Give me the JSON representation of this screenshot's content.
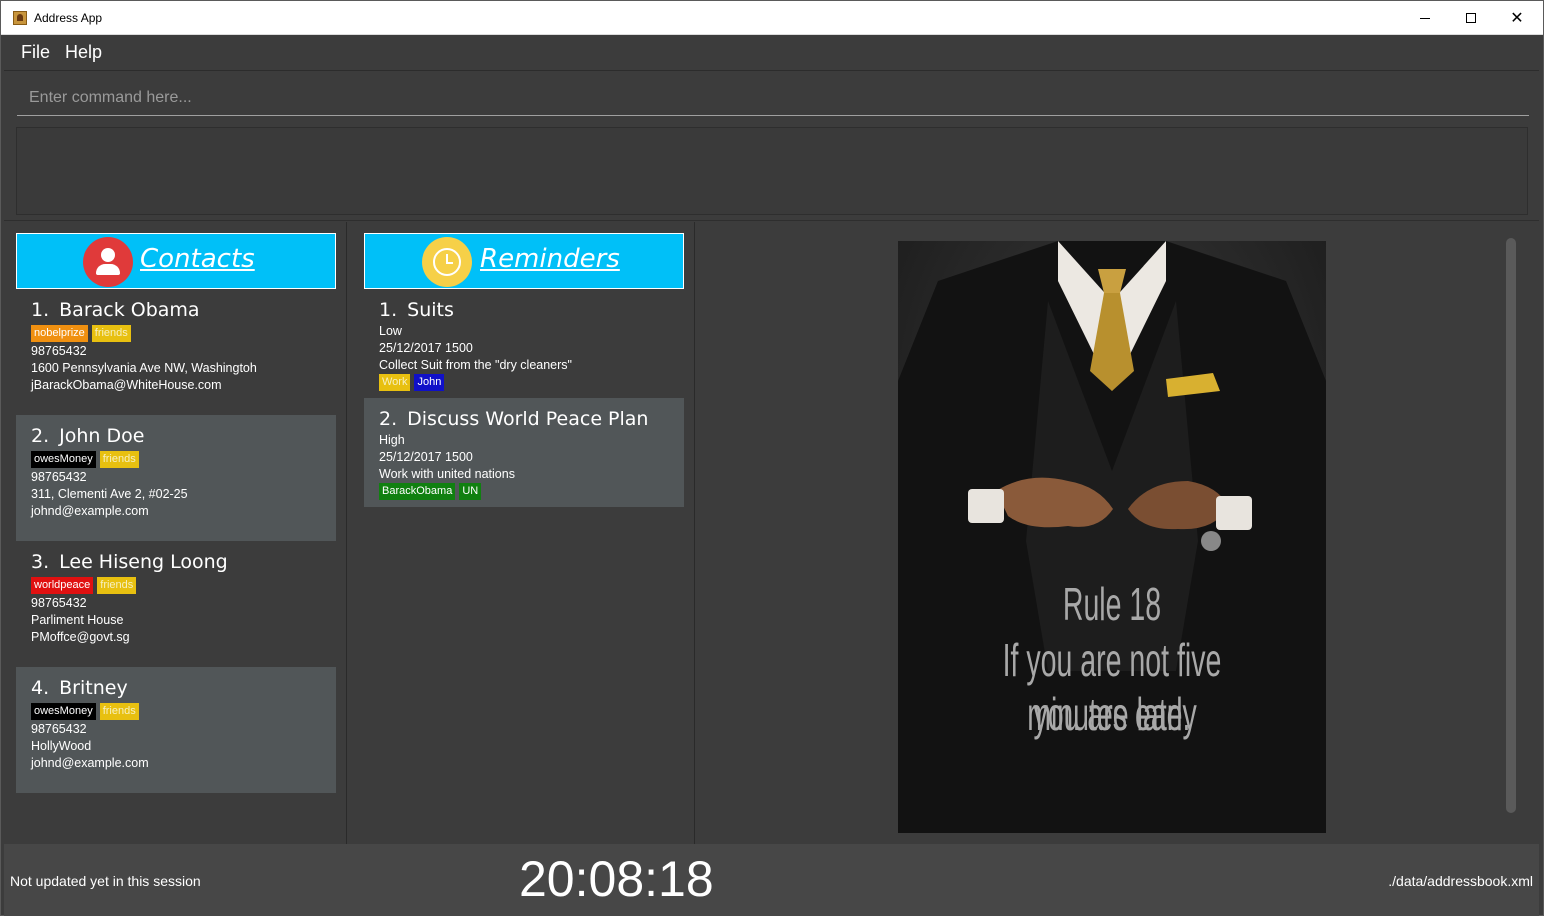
{
  "window": {
    "title": "Address App",
    "app_icon": "address-book-icon",
    "controls": {
      "minimize": "minimize-icon",
      "maximize": "maximize-icon",
      "close": "close-icon"
    }
  },
  "menu": {
    "file": "File",
    "help": "Help"
  },
  "command": {
    "placeholder": "Enter command here...",
    "value": ""
  },
  "result_display": {
    "text": ""
  },
  "contacts": {
    "header": "Contacts",
    "icon": "person-icon",
    "items": [
      {
        "index": "1.",
        "name": "Barack Obama",
        "tags": [
          {
            "label": "nobelprize",
            "color": "#f09010"
          },
          {
            "label": "friends",
            "color": "#e8c010"
          }
        ],
        "phone": "98765432",
        "address": "1600 Pennsylvania Ave NW, Washingtoh",
        "email": "jBarackObama@WhiteHouse.com"
      },
      {
        "index": "2.",
        "name": "John Doe",
        "tags": [
          {
            "label": "owesMoney",
            "color": "#000000"
          },
          {
            "label": "friends",
            "color": "#e8c010"
          }
        ],
        "phone": "98765432",
        "address": "311, Clementi Ave 2, #02-25",
        "email": "johnd@example.com"
      },
      {
        "index": "3.",
        "name": "Lee Hiseng Loong",
        "tags": [
          {
            "label": "worldpeace",
            "color": "#e01010"
          },
          {
            "label": "friends",
            "color": "#e8c010"
          }
        ],
        "phone": "98765432",
        "address": "Parliment House",
        "email": "PMoffce@govt.sg"
      },
      {
        "index": "4.",
        "name": "Britney",
        "tags": [
          {
            "label": "owesMoney",
            "color": "#000000"
          },
          {
            "label": "friends",
            "color": "#e8c010"
          }
        ],
        "phone": "98765432",
        "address": "HollyWood",
        "email": "johnd@example.com"
      }
    ]
  },
  "reminders": {
    "header": "Reminders",
    "icon": "alarm-clock-icon",
    "items": [
      {
        "index": "1.",
        "title": "Suits",
        "priority": "Low",
        "datetime": "25/12/2017 1500",
        "note": "Collect Suit from the \"dry cleaners\"",
        "tags": [
          {
            "label": "Work",
            "color": "#e8c010"
          },
          {
            "label": "John",
            "color": "#1010c8"
          }
        ]
      },
      {
        "index": "2.",
        "title": "Discuss World Peace Plan",
        "priority": "High",
        "datetime": "25/12/2017 1500",
        "note": "Work with united nations",
        "tags": [
          {
            "label": "BarackObama",
            "color": "#108010"
          },
          {
            "label": "UN",
            "color": "#108010"
          }
        ]
      }
    ]
  },
  "poster": {
    "line1": "Rule 18",
    "line2": "If you are not five minutes early",
    "line3": "you are late."
  },
  "status": {
    "sync": "Not updated yet in this session",
    "clock": "20:08:18",
    "path": "./data/addressbook.xml"
  }
}
